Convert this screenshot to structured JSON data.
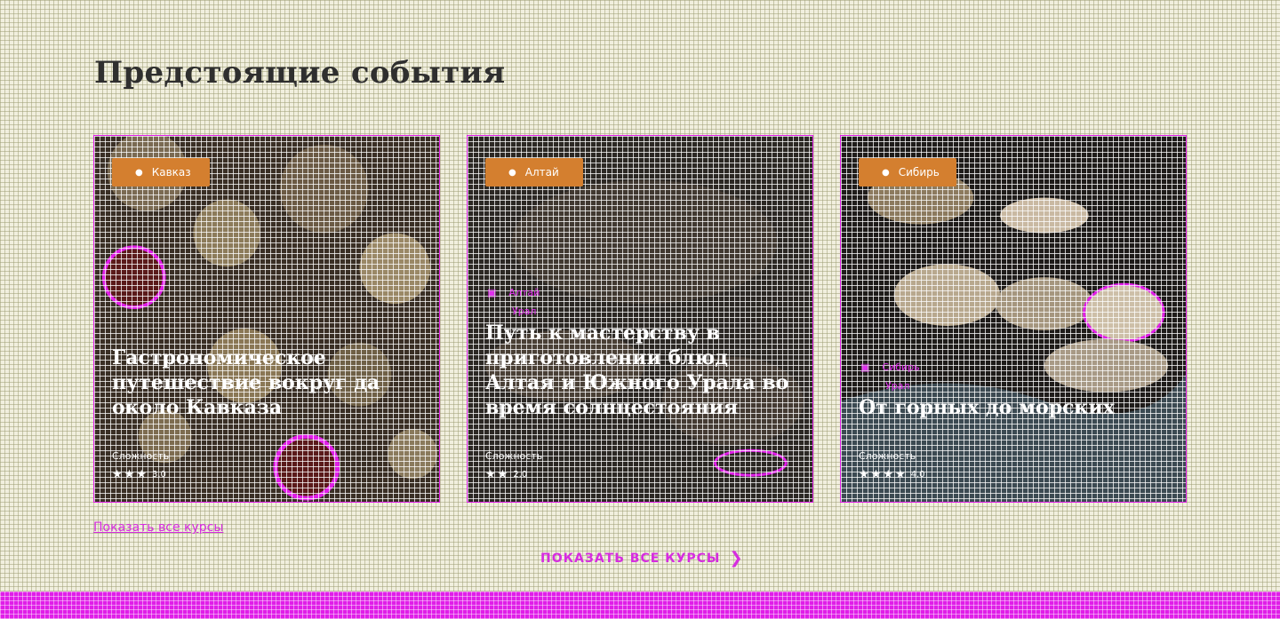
{
  "page": {
    "title": "Предстоящие события"
  },
  "cards": [
    {
      "badge": "Кавказ",
      "meta": [
        "",
        ""
      ],
      "title": "Гастрономическое путешествие вокруг да около Кавказа",
      "difficulty_label": "Сложность",
      "rating_stars": 3,
      "rating_score": "3.0"
    },
    {
      "badge": "Алтай",
      "meta": [
        "Алтай",
        "Урал"
      ],
      "title": "Путь к мастерству в приготовлении блюд Алтая и Южного Урала во время солнцестояния",
      "difficulty_label": "Сложность",
      "rating_stars": 2,
      "rating_score": "2.0"
    },
    {
      "badge": "Сибирь",
      "meta": [
        "Сибирь",
        "Урал"
      ],
      "title": "От горных до морских",
      "difficulty_label": "Сложность",
      "rating_stars": 4,
      "rating_score": "4.0"
    }
  ],
  "links": {
    "show_all_link": "Показать все курсы",
    "show_all_button": "ПОКАЗАТЬ ВСЕ КУРСЫ"
  },
  "icons": {
    "badge": "map-pin-icon",
    "meta": "calendar-icon",
    "chevron": "chevron-right-icon"
  },
  "colors": {
    "accent": "#e01ee8",
    "badge": "#d47f2f",
    "background": "#f1efde"
  }
}
